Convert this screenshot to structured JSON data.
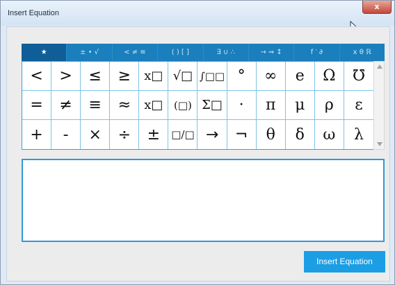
{
  "window": {
    "title": "Insert Equation",
    "close_label": "x"
  },
  "tabs": [
    {
      "label": "★",
      "active": true
    },
    {
      "label": "± • √",
      "active": false
    },
    {
      "label": "< ≠ ≡",
      "active": false
    },
    {
      "label": "( ) [ ]",
      "active": false
    },
    {
      "label": "∃ ∪ ∴",
      "active": false
    },
    {
      "label": "→ ⇒ ↕",
      "active": false
    },
    {
      "label": "f ′ ∂",
      "active": false
    },
    {
      "label": "x θ ℝ",
      "active": false
    }
  ],
  "symbols": [
    [
      "<",
      ">",
      "≤",
      "≥",
      "x□",
      "√□",
      "∫□□",
      "°",
      "∞",
      "e",
      "Ω",
      "℧"
    ],
    [
      "=",
      "≠",
      "≡",
      "≈",
      "x□",
      "(□)",
      "Σ□",
      "·",
      "π",
      "μ",
      "ρ",
      "ε"
    ],
    [
      "+",
      "-",
      "×",
      "÷",
      "±",
      "□/□",
      "→",
      "¬",
      "θ",
      "δ",
      "ω",
      "λ"
    ]
  ],
  "editor": {
    "value": ""
  },
  "insert_button": {
    "label": "Insert Equation"
  }
}
